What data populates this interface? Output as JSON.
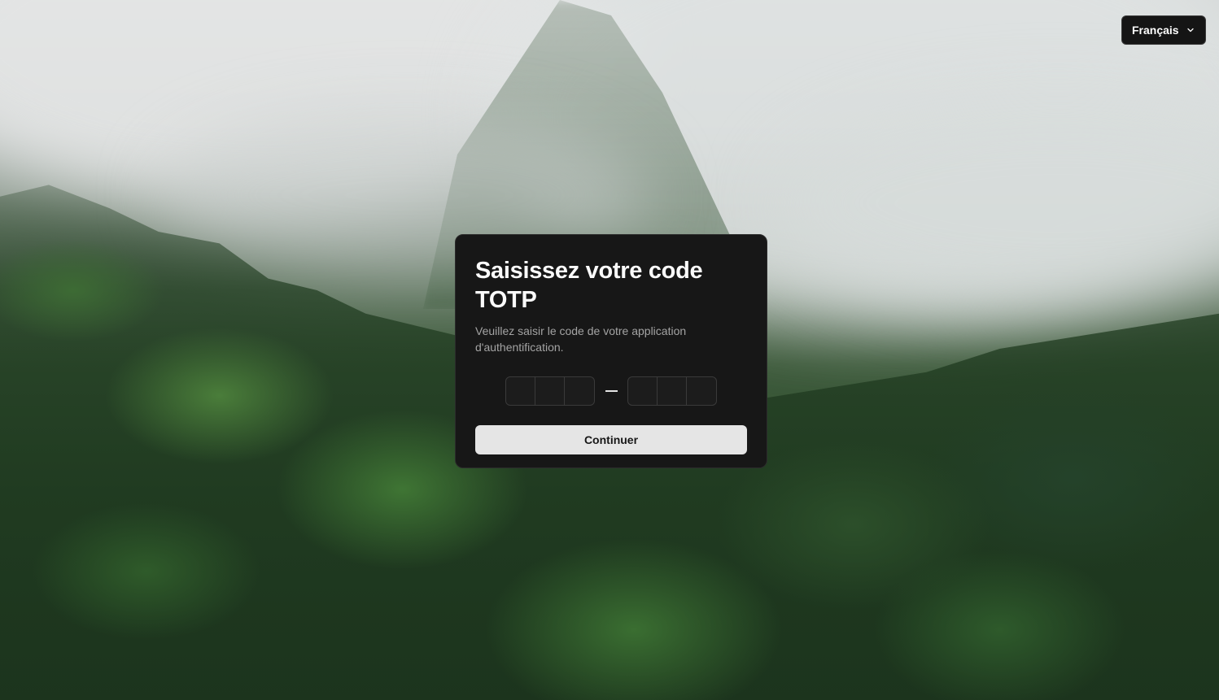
{
  "language_selector": {
    "label": "Français",
    "icon": "chevron-down-icon"
  },
  "card": {
    "title": "Saisissez votre code TOTP",
    "subtitle": "Veuillez saisir le code de votre application d'authentification.",
    "otp": {
      "group_1": [
        "",
        "",
        ""
      ],
      "group_2": [
        "",
        "",
        ""
      ]
    },
    "continue_label": "Continuer"
  },
  "colors": {
    "card_bg": "#171717",
    "button_bg": "#e5e5e5",
    "button_text": "#171717"
  }
}
